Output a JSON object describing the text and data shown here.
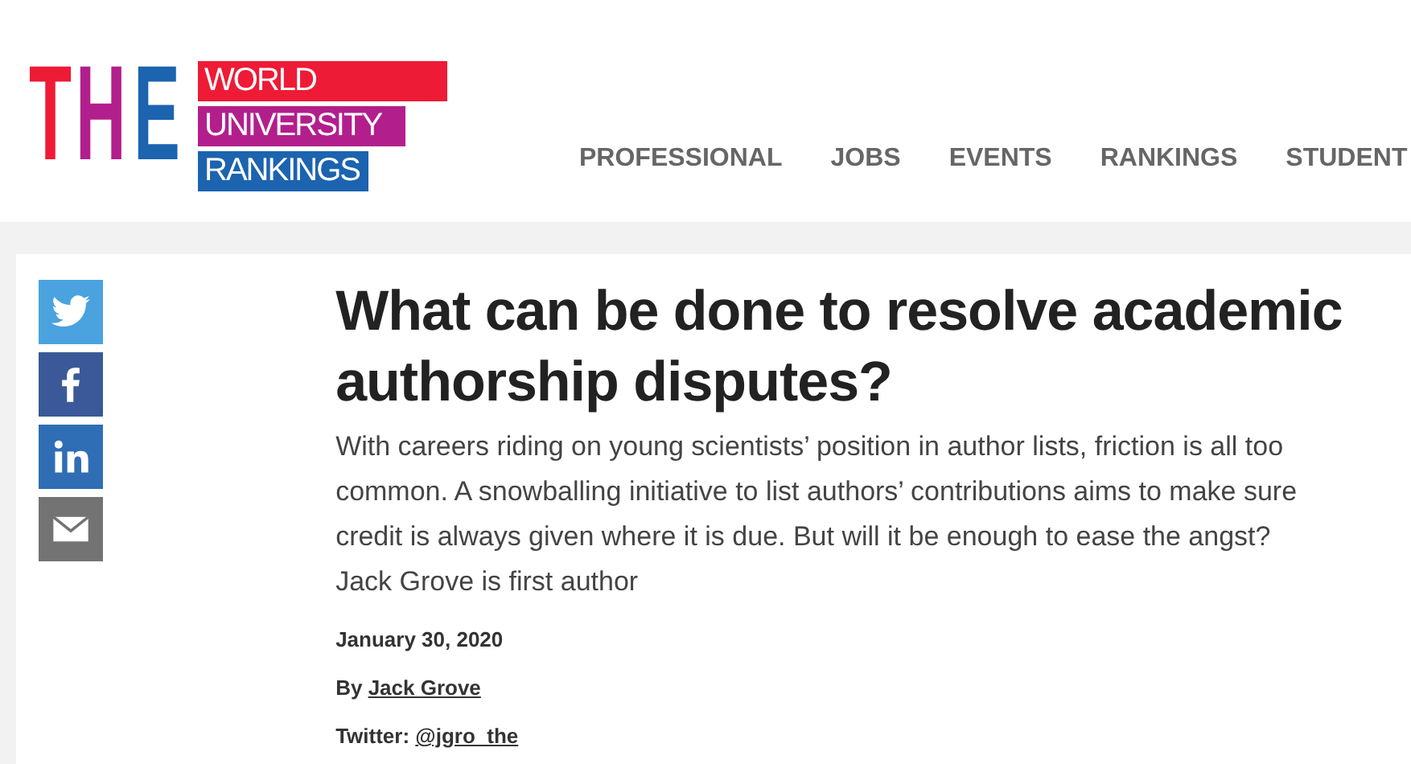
{
  "logo": {
    "letters": [
      {
        "text": "T",
        "color": "#ee1b36"
      },
      {
        "text": "H",
        "color": "#b21f8c"
      },
      {
        "text": "E",
        "color": "#1c63b0"
      }
    ],
    "bands": [
      {
        "text": "WORLD",
        "color": "#ee1b36"
      },
      {
        "text": "UNIVERSITY",
        "color": "#b21f8c"
      },
      {
        "text": "RANKINGS",
        "color": "#1c63b0"
      }
    ]
  },
  "nav": [
    "PROFESSIONAL",
    "JOBS",
    "EVENTS",
    "RANKINGS",
    "STUDENT"
  ],
  "share": [
    {
      "kind": "twitter",
      "color": "#4aa3df"
    },
    {
      "kind": "facebook",
      "color": "#3b5998"
    },
    {
      "kind": "linkedin",
      "color": "#2f6eb5"
    },
    {
      "kind": "email",
      "color": "#737373"
    }
  ],
  "article": {
    "title": "What can be done to resolve academic authorship disputes?",
    "standfirst": "With careers riding on young scientists’ position in author lists, friction is all too common. A snowballing initiative to list authors’ contributions aims to make sure credit is always given where it is due. But will it be enough to ease the angst? Jack Grove is first author",
    "date": "January 30, 2020",
    "by_label": "By",
    "author": "Jack Grove",
    "twitter_label": "Twitter:",
    "twitter_handle": "@jgro_the"
  }
}
